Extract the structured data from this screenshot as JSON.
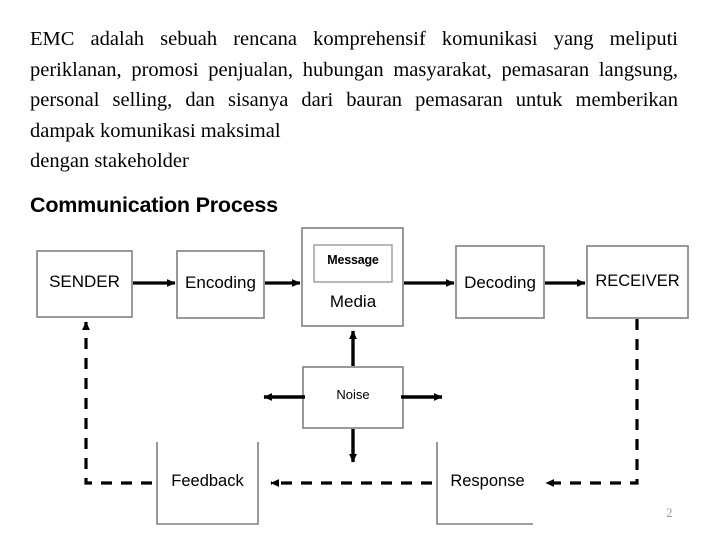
{
  "slide": {
    "paragraph": "EMC adalah sebuah rencana komprehensif komunikasi yang meliputi periklanan, promosi penjualan, hubungan masyarakat, pemasaran langsung, personal selling, dan sisanya dari bauran pemasaran untuk memberikan dampak komunikasi maksimal",
    "paragraph_last_line": "dengan stakeholder",
    "heading": "Communication Process",
    "page_number": "2"
  },
  "diagram": {
    "type": "flow-diagram",
    "title": "Communication Process",
    "nodes": [
      {
        "id": "sender",
        "label": "SENDER"
      },
      {
        "id": "encoding",
        "label": "Encoding"
      },
      {
        "id": "message",
        "label": "Message"
      },
      {
        "id": "media",
        "label": "Media"
      },
      {
        "id": "decoding",
        "label": "Decoding"
      },
      {
        "id": "receiver",
        "label": "RECEIVER"
      },
      {
        "id": "noise",
        "label": "Noise"
      },
      {
        "id": "feedback",
        "label": "Feedback"
      },
      {
        "id": "response",
        "label": "Response"
      }
    ],
    "edges": [
      {
        "from": "sender",
        "to": "encoding",
        "style": "solid"
      },
      {
        "from": "encoding",
        "to": "media",
        "style": "solid"
      },
      {
        "from": "media",
        "to": "decoding",
        "style": "solid"
      },
      {
        "from": "decoding",
        "to": "receiver",
        "style": "solid"
      },
      {
        "from": "noise",
        "to": "media",
        "style": "solid"
      },
      {
        "from": "noise",
        "to": "left",
        "style": "solid"
      },
      {
        "from": "noise",
        "to": "right",
        "style": "solid"
      },
      {
        "from": "noise",
        "to": "down",
        "style": "solid"
      },
      {
        "from": "receiver",
        "to": "response",
        "style": "dashed"
      },
      {
        "from": "response",
        "to": "feedback",
        "style": "dashed"
      },
      {
        "from": "feedback",
        "to": "sender",
        "style": "dashed"
      }
    ],
    "colors": {
      "box_border": "#808080",
      "arrow": "#000000",
      "text": "#000000",
      "background": "#ffffff",
      "page_number": "#9a9a9a"
    }
  }
}
